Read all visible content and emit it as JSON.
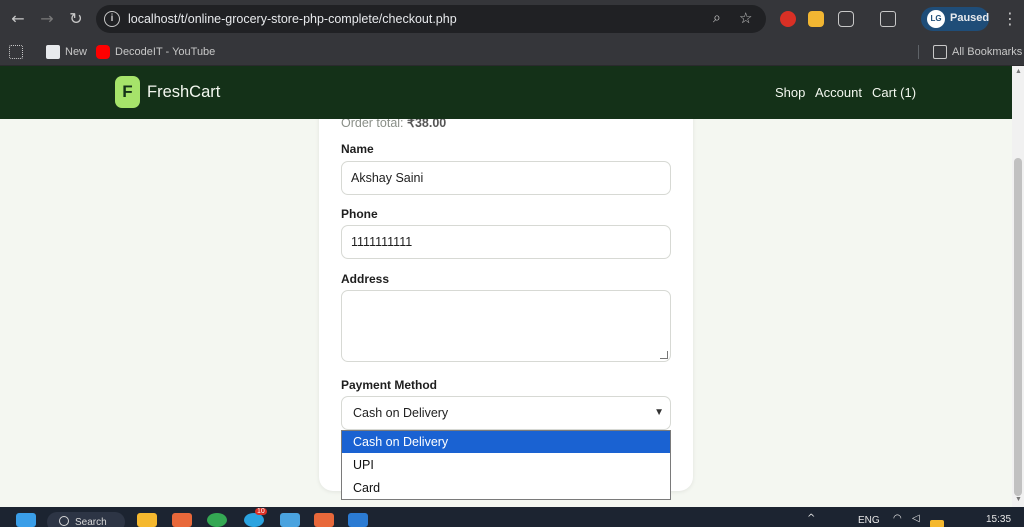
{
  "browser": {
    "url": "localhost/t/online-grocery-store-php-complete/checkout.php",
    "profile_status": "Paused",
    "profile_initials": "LG"
  },
  "bookmarks": {
    "items": [
      {
        "label": "New",
        "icon": "new-tab-icon"
      },
      {
        "label": "DecodeIT - YouTube",
        "icon": "youtube-icon"
      }
    ],
    "all_bookmarks": "All Bookmarks"
  },
  "site": {
    "logo_letter": "F",
    "brand": "FreshCart",
    "nav": {
      "shop": "Shop",
      "account": "Account",
      "cart": "Cart (1)"
    },
    "colors": {
      "header_bg": "#143118",
      "logo_bg": "#a6e36a",
      "page_bg": "#f4f7f1",
      "selected_option": "#1a62d2"
    }
  },
  "checkout": {
    "order_total_label": "Order total:",
    "order_total_value": "₹38.00",
    "name_label": "Name",
    "name_value": "Akshay Saini",
    "phone_label": "Phone",
    "phone_value": "1111111111",
    "address_label": "Address",
    "address_value": "",
    "payment_label": "Payment Method",
    "payment_selected": "Cash on Delivery",
    "payment_options": [
      "Cash on Delivery",
      "UPI",
      "Card"
    ]
  },
  "taskbar": {
    "search_label": "Search",
    "language": "ENG",
    "time": "15:35",
    "badge_count": "10"
  }
}
